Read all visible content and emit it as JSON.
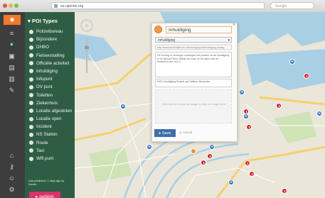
{
  "browser": {
    "url": "ea.openter.org",
    "search_placeholder": "Google"
  },
  "rail": {
    "icons": [
      "logo-icon",
      "list-icon",
      "pin-icon",
      "cube-icon",
      "layers-icon",
      "trash-icon",
      "tools-icon",
      "home-icon",
      "key-icon",
      "user-icon",
      "settings-icon"
    ]
  },
  "panel": {
    "title": "POI Types",
    "items": [
      "Polizeibureau",
      "Bijzondere",
      "DHBO",
      "Fietsenstalling",
      "Officiële activiteit",
      "Inhuldiging",
      "Infopunt",
      "OV punt",
      "Toiletten",
      "Ziekenhuis",
      "Locatie afgesloten",
      "Locatie open",
      "Incident",
      "NS Station",
      "Route",
      "Taxi",
      "Wifi punt"
    ],
    "last_published": "Last published: 1 days ago by Dexter",
    "publish_label": "publish"
  },
  "dialog": {
    "title_value": "Inhuldiging",
    "type_value": "Inhuldiging",
    "url_value": "http://www.koninklijkhuis.nl/inhuldiging/nl/inhuldiging-koning",
    "body_text": "De Koning en Koningin ontvangen het publiek na de inhuldiging in de Nieuwe Kerk. Bekijk de route en de tijden van de boottocht over het IJ.",
    "body_text2": "NOS Inhuldiging Beatrix and Willem-Alexander",
    "drop_text": "Click here to choose an image or drop an image here",
    "save_label": "Save",
    "cancel_label": "or cancel"
  }
}
